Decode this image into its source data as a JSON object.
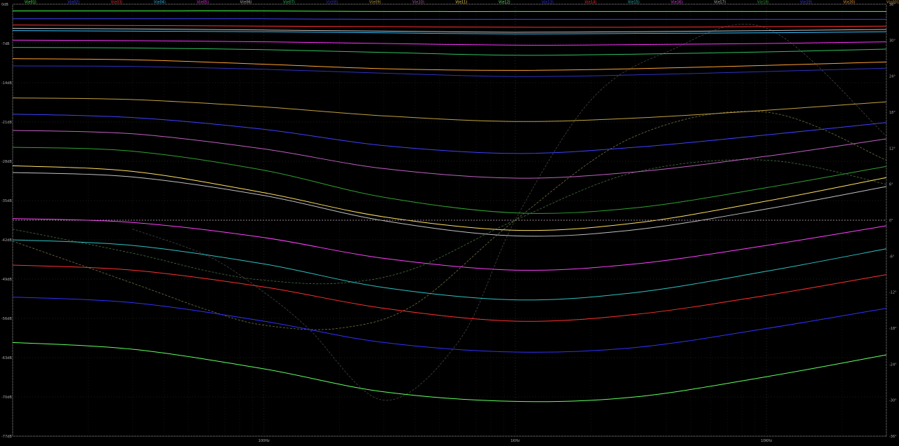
{
  "chart_data": {
    "type": "line",
    "background": "#000000",
    "grid": true,
    "legend_placement": "top",
    "x_scale": "log",
    "x_range_hz": [
      10,
      30000
    ],
    "x_ticks": [
      {
        "value": 100,
        "label": "100Hz"
      },
      {
        "value": 1000,
        "label": "1KHz"
      },
      {
        "value": 10000,
        "label": "10KHz"
      }
    ],
    "y_left": {
      "range": [
        -77,
        0
      ],
      "ticks": [
        {
          "value": 0,
          "label": "0dB"
        },
        {
          "value": -7,
          "label": "-7dB"
        },
        {
          "value": -14,
          "label": "-14dB"
        },
        {
          "value": -21,
          "label": "-21dB"
        },
        {
          "value": -28,
          "label": "-28dB"
        },
        {
          "value": -35,
          "label": "-35dB"
        },
        {
          "value": -42,
          "label": "-42dB"
        },
        {
          "value": -49,
          "label": "-49dB"
        },
        {
          "value": -56,
          "label": "-56dB"
        },
        {
          "value": -63,
          "label": "-63dB"
        },
        {
          "value": -70,
          "label": "-70dB"
        },
        {
          "value": -77,
          "label": "-77dB"
        }
      ]
    },
    "y_right": {
      "range": [
        -36,
        36
      ],
      "ticks": [
        {
          "value": 36,
          "label": "36°"
        },
        {
          "value": 30,
          "label": "30°"
        },
        {
          "value": 24,
          "label": "24°"
        },
        {
          "value": 18,
          "label": "18°"
        },
        {
          "value": 12,
          "label": "12°"
        },
        {
          "value": 6,
          "label": "6°"
        },
        {
          "value": 0,
          "label": "0°"
        },
        {
          "value": -6,
          "label": "-6°"
        },
        {
          "value": -12,
          "label": "-12°"
        },
        {
          "value": -18,
          "label": "-18°"
        },
        {
          "value": -24,
          "label": "-24°"
        },
        {
          "value": -30,
          "label": "-30°"
        },
        {
          "value": -36,
          "label": "-36°"
        }
      ]
    },
    "series_x_hz": [
      10,
      30,
      100,
      300,
      1000,
      3000,
      10000,
      30000
    ],
    "series": [
      {
        "name": "V(e01)",
        "color": "#40ff40",
        "values": [
          -1.2,
          -1.2,
          -1.2,
          -1.3,
          -1.3,
          -1.3,
          -1.3,
          -1.3
        ],
        "phase": [
          0,
          0,
          0,
          0,
          0,
          0,
          0,
          0
        ]
      },
      {
        "name": "V(e02)",
        "color": "#4040ff",
        "values": [
          -2.6,
          -2.6,
          -2.6,
          -2.7,
          -2.7,
          -2.7,
          -2.7,
          -2.7
        ],
        "phase": [
          0,
          0,
          0,
          0,
          0,
          0,
          0,
          0
        ]
      },
      {
        "name": "V(e03)",
        "color": "#ff3030",
        "values": [
          -3.7,
          -3.8,
          -3.9,
          -4.0,
          -4.1,
          -4.1,
          -4.0,
          -3.9
        ],
        "phase": [
          0,
          0,
          0,
          0,
          0,
          0,
          0,
          0
        ]
      },
      {
        "name": "V(e04)",
        "color": "#30c0ff",
        "values": [
          -4.7,
          -4.8,
          -4.9,
          -5.1,
          -5.3,
          -5.2,
          -5.1,
          -4.9
        ],
        "phase": [
          0,
          0,
          0,
          0,
          0,
          0,
          0,
          0
        ]
      },
      {
        "name": "V(e05)",
        "color": "#ff30ff",
        "values": [
          -6.4,
          -6.5,
          -6.7,
          -7.0,
          -7.3,
          -7.2,
          -7.0,
          -6.7
        ],
        "phase": [
          0,
          0,
          0,
          0,
          0,
          0,
          0,
          0
        ]
      },
      {
        "name": "V(e06)",
        "color": "#c0c0c0",
        "values": [
          -4.3,
          -4.4,
          -4.6,
          -4.8,
          -5.0,
          -4.9,
          -4.7,
          -4.5
        ],
        "phase": [
          0,
          0,
          0,
          0,
          0,
          0,
          0,
          0
        ]
      },
      {
        "name": "V(e07)",
        "color": "#30c060",
        "values": [
          -7.7,
          -7.8,
          -8.1,
          -8.6,
          -9.1,
          -8.9,
          -8.5,
          -8.0
        ],
        "phase": [
          0,
          0,
          0,
          0,
          0,
          0,
          0,
          0
        ]
      },
      {
        "name": "V(e08)",
        "color": "#3030c0",
        "values": [
          -11.0,
          -11.1,
          -11.6,
          -12.3,
          -12.9,
          -12.6,
          -12.0,
          -11.4
        ],
        "phase": [
          0,
          0,
          0,
          0,
          0,
          0,
          0,
          0
        ]
      },
      {
        "name": "V(e09)",
        "color": "#c0a040",
        "values": [
          -16.7,
          -17.0,
          -18.3,
          -19.9,
          -20.9,
          -20.3,
          -18.9,
          -17.4
        ],
        "phase": [
          0,
          0,
          0,
          0,
          0,
          0,
          0,
          0
        ]
      },
      {
        "name": "V(e10)",
        "color": "#c060c0",
        "values": [
          -22.5,
          -23.1,
          -25.8,
          -29.3,
          -31.0,
          -29.9,
          -27.1,
          -24.0
        ],
        "phase": [
          0,
          0,
          0,
          0,
          0,
          0,
          0,
          0
        ]
      },
      {
        "name": "V(e11)",
        "color": "#ffe060",
        "values": [
          -28.8,
          -29.8,
          -33.6,
          -37.9,
          -40.3,
          -39.0,
          -35.1,
          -30.9
        ],
        "phase": [
          0,
          0,
          0,
          0,
          0,
          0,
          0,
          0
        ]
      },
      {
        "name": "V(e12)",
        "color": "#60ff60",
        "values": [
          -60.3,
          -61.5,
          -65.0,
          -69.1,
          -70.8,
          -70.0,
          -66.4,
          -62.5
        ],
        "phase": [
          0,
          0,
          0,
          0,
          0,
          0,
          0,
          0
        ]
      },
      {
        "name": "V(e13)",
        "color": "#3030ff",
        "values": [
          -52.2,
          -53.2,
          -56.5,
          -60.3,
          -62.0,
          -61.2,
          -57.8,
          -54.2
        ],
        "phase": [
          0,
          0,
          0,
          0,
          0,
          0,
          0,
          0
        ]
      },
      {
        "name": "V(e14)",
        "color": "#ff3030",
        "values": [
          -46.5,
          -47.4,
          -50.4,
          -54.2,
          -56.5,
          -55.3,
          -51.9,
          -48.2
        ],
        "phase": [
          0,
          0,
          0,
          0,
          0,
          0,
          0,
          0
        ]
      },
      {
        "name": "V(e15)",
        "color": "#30c0c0",
        "values": [
          -42.0,
          -43.0,
          -46.3,
          -50.5,
          -52.7,
          -51.4,
          -47.6,
          -43.6
        ],
        "phase": [
          0,
          0,
          0,
          0,
          0,
          0,
          0,
          0
        ]
      },
      {
        "name": "V(e16)",
        "color": "#ff40ff",
        "values": [
          -38.2,
          -38.9,
          -41.6,
          -45.3,
          -47.4,
          -46.3,
          -43.0,
          -39.5
        ],
        "phase": [
          0,
          0,
          0,
          0,
          0,
          0,
          0,
          0
        ]
      },
      {
        "name": "V(e17)",
        "color": "#c0c0c0",
        "values": [
          -30.0,
          -30.8,
          -34.1,
          -38.6,
          -41.3,
          -40.2,
          -36.5,
          -32.5
        ],
        "phase": [
          0,
          0,
          0,
          0,
          0,
          0,
          0,
          0
        ]
      },
      {
        "name": "V(e18)",
        "color": "#30a030",
        "values": [
          -25.5,
          -26.2,
          -29.6,
          -34.4,
          -37.2,
          -36.3,
          -32.7,
          -28.9
        ],
        "phase": [
          0,
          0,
          0,
          0,
          0,
          0,
          0,
          0
        ]
      },
      {
        "name": "V(e19)",
        "color": "#4040ff",
        "values": [
          -19.6,
          -20.2,
          -22.3,
          -25.2,
          -26.6,
          -25.5,
          -23.3,
          -21.1
        ],
        "phase": [
          0,
          0,
          0,
          0,
          0,
          0,
          0,
          0
        ]
      },
      {
        "name": "V(e20)",
        "color": "#ffa030",
        "values": [
          -9.7,
          -9.9,
          -10.7,
          -11.5,
          -11.8,
          -11.5,
          -10.9,
          -10.3
        ],
        "phase": [
          0,
          0,
          0,
          0,
          0,
          0,
          0,
          0
        ]
      }
    ],
    "phase_traces": [
      {
        "color": "#a0a060",
        "x_hz": [
          10,
          30,
          60,
          100,
          200,
          400,
          1000,
          3000,
          10000,
          30000
        ],
        "phase": [
          -3.5,
          -10.5,
          -15.0,
          -17.5,
          -18.0,
          -14.0,
          0.0,
          14.0,
          18.0,
          10.0
        ]
      },
      {
        "color": "#60a060",
        "x_hz": [
          10,
          30,
          60,
          100,
          200,
          400,
          1000,
          3000,
          10000,
          30000
        ],
        "phase": [
          -1.5,
          -5.5,
          -8.5,
          -10.0,
          -10.5,
          -8.0,
          0.0,
          8.0,
          10.0,
          6.0
        ]
      },
      {
        "color": "#606060",
        "x_hz": [
          30,
          60,
          100,
          150,
          300,
          600,
          1000,
          2000,
          4000,
          10000,
          30000
        ],
        "phase": [
          -1.5,
          -6.0,
          -12.0,
          -18.0,
          -30.0,
          -20.0,
          0.0,
          20.0,
          28.0,
          32.0,
          14.0
        ]
      }
    ]
  },
  "legend": [
    {
      "label": "V(e01)",
      "color": "#40ff40"
    },
    {
      "label": "V(e02)",
      "color": "#4040ff"
    },
    {
      "label": "V(e03)",
      "color": "#ff3030"
    },
    {
      "label": "V(e04)",
      "color": "#30c0ff"
    },
    {
      "label": "V(e05)",
      "color": "#ff30ff"
    },
    {
      "label": "V(e06)",
      "color": "#c0c0c0"
    },
    {
      "label": "V(e07)",
      "color": "#30c060"
    },
    {
      "label": "V(e08)",
      "color": "#3030c0"
    },
    {
      "label": "V(e09)",
      "color": "#c0a040"
    },
    {
      "label": "V(e10)",
      "color": "#c060c0"
    },
    {
      "label": "V(e11)",
      "color": "#ffe060"
    },
    {
      "label": "V(e12)",
      "color": "#60ff60"
    },
    {
      "label": "V(e13)",
      "color": "#3030ff"
    },
    {
      "label": "V(e14)",
      "color": "#ff3030"
    },
    {
      "label": "V(e15)",
      "color": "#30c0c0"
    },
    {
      "label": "V(e16)",
      "color": "#ff40ff"
    },
    {
      "label": "V(e17)",
      "color": "#c0c0c0"
    },
    {
      "label": "V(e18)",
      "color": "#30a030"
    },
    {
      "label": "V(e19)",
      "color": "#4040ff"
    },
    {
      "label": "V(e20)",
      "color": "#ffa030"
    },
    {
      "label": "V(n001)",
      "color": "#d09030"
    }
  ]
}
